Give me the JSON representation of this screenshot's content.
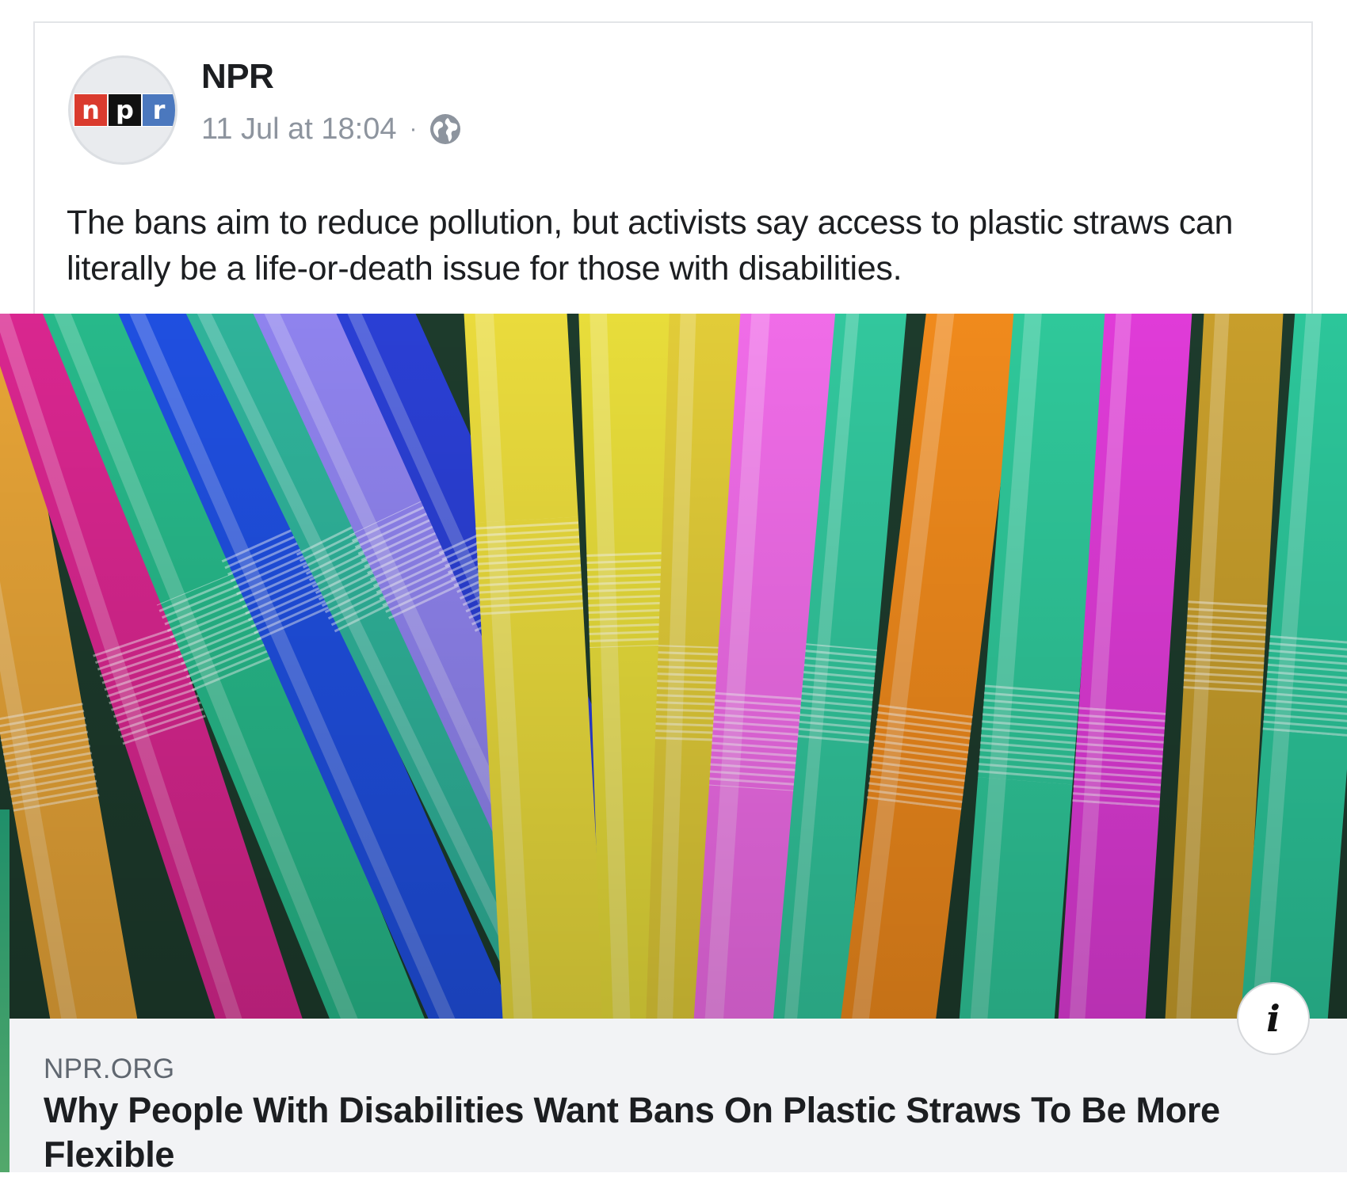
{
  "post": {
    "page_name": "NPR",
    "avatar_logo_letters": [
      "n",
      "p",
      "r"
    ],
    "timestamp": "11 Jul at 18:04",
    "separator": "·",
    "audience_icon": "globe-icon",
    "text": "The bans aim to reduce pollution, but activists say access to plastic straws can literally be a life-or-death issue for those with disabilities."
  },
  "link_preview": {
    "image_subject": "colorful bendy plastic straws",
    "domain": "NPR.ORG",
    "title": "Why People With Disabilities Want Bans On Plastic Straws To Be More Flexible",
    "info_icon": "info-icon",
    "info_label": "i"
  },
  "colors": {
    "npr_red": "#da3b2e",
    "npr_black": "#111111",
    "npr_blue": "#4b78be",
    "meta_gray": "#8d949e",
    "footer_bg": "#f2f3f5"
  }
}
